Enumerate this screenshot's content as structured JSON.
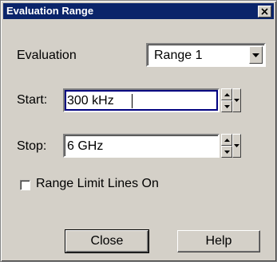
{
  "window": {
    "title": "Evaluation Range",
    "close_icon": "close-icon"
  },
  "evaluation": {
    "label": "Evaluation",
    "selected": "Range 1"
  },
  "start": {
    "label": "Start:",
    "value": "300 kHz"
  },
  "stop": {
    "label": "Stop:",
    "value": "6 GHz"
  },
  "range_limit": {
    "label": "Range Limit Lines On",
    "checked": false
  },
  "buttons": {
    "close_label": "Close",
    "help_label": "Help"
  },
  "colors": {
    "titlebar": "#0a246a",
    "dialog_bg": "#d4d0c8",
    "focus": "#000080"
  }
}
